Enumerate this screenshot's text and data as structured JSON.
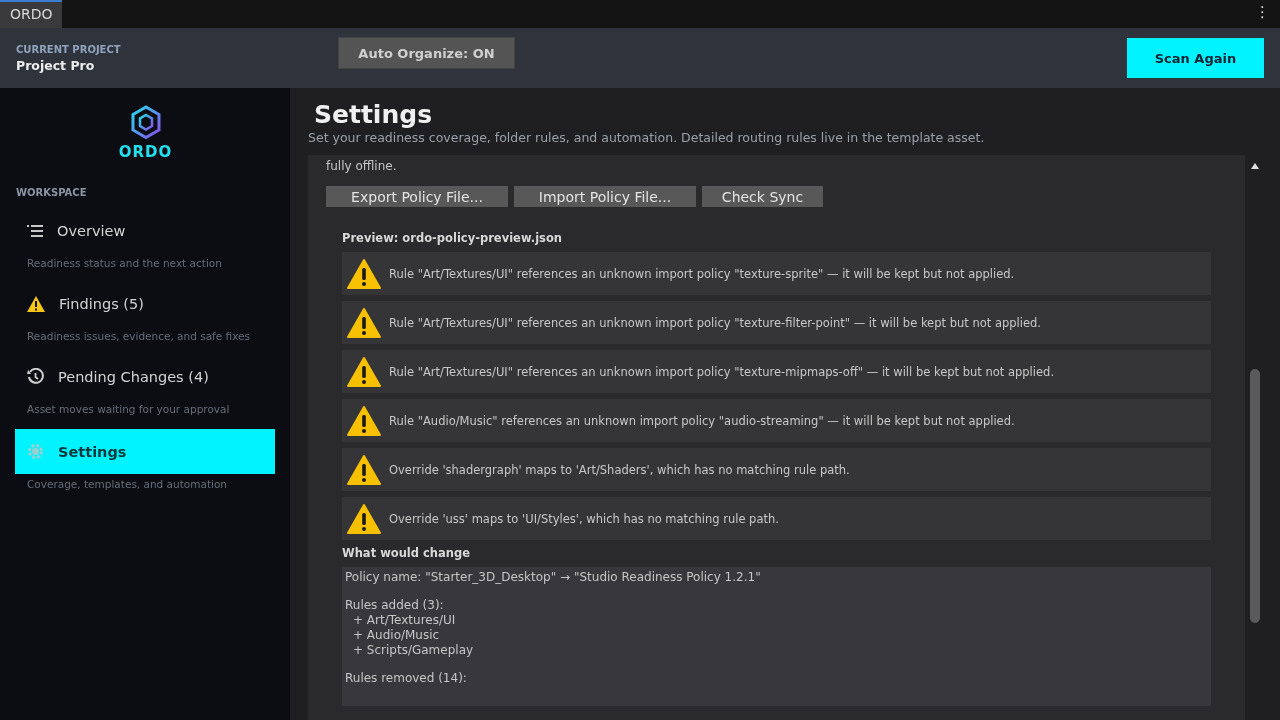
{
  "title_bar": {
    "tab": "ORDO",
    "menu": "⋮"
  },
  "header": {
    "project_label": "CURRENT PROJECT",
    "project_name": "Project Pro",
    "auto_organize": "Auto Organize: ON",
    "scan_button": "Scan Again"
  },
  "sidebar": {
    "logo": "ORDO",
    "section": "WORKSPACE",
    "items": [
      {
        "kind": "list",
        "label": "Overview",
        "description": "Readiness status and the next action",
        "selected": false
      },
      {
        "kind": "warning",
        "label": "Findings (5)",
        "description": "Readiness issues, evidence, and safe fixes",
        "selected": false
      },
      {
        "kind": "history",
        "label": "Pending Changes (4)",
        "description": "Asset moves waiting for your approval",
        "selected": false
      },
      {
        "kind": "gear",
        "label": "Settings",
        "description": "Coverage, templates, and automation",
        "selected": true
      }
    ]
  },
  "main": {
    "title": "Settings",
    "subtitle": "Set your readiness coverage, folder rules, and automation. Detailed routing rules live in the template asset.",
    "intro_tail": "fully offline.",
    "buttons": [
      "Export Policy File...",
      "Import Policy File...",
      "Check Sync"
    ],
    "preview_title": "Preview: ordo-policy-preview.json",
    "warnings": [
      "Rule \"Art/Textures/UI\" references an unknown import policy \"texture-sprite\" — it will be kept but not applied.",
      "Rule \"Art/Textures/UI\" references an unknown import policy \"texture-filter-point\" — it will be kept but not applied.",
      "Rule \"Art/Textures/UI\" references an unknown import policy \"texture-mipmaps-off\" — it will be kept but not applied.",
      "Rule \"Audio/Music\" references an unknown import policy \"audio-streaming\" — it will be kept but not applied.",
      "Override 'shadergraph' maps to 'Art/Shaders', which has no matching rule path.",
      "Override 'uss' maps to 'UI/Styles', which has no matching rule path."
    ],
    "changes_title": "What would change",
    "changes": [
      {
        "heading": "Policy name: \"Starter_3D_Desktop\" → \"Studio Readiness Policy 1.2.1\""
      },
      {
        "heading": "Rules added (3):",
        "lines": [
          "+ Art/Textures/UI",
          "+ Audio/Music",
          "+ Scripts/Gameplay"
        ]
      },
      {
        "heading": "Rules removed (14):"
      }
    ]
  }
}
